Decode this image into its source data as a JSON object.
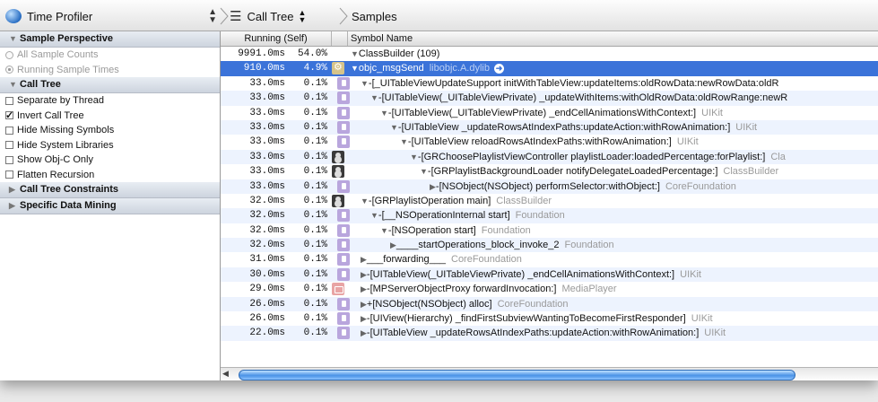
{
  "toolbar": {
    "instrument": "Time Profiler",
    "breadcrumb_1": "Call Tree",
    "breadcrumb_2": "Samples"
  },
  "sidebar": {
    "sample_perspective": {
      "title": "Sample Perspective",
      "options": [
        {
          "label": "All Sample Counts",
          "selected": false
        },
        {
          "label": "Running Sample Times",
          "selected": true
        }
      ]
    },
    "call_tree": {
      "title": "Call Tree",
      "options": [
        {
          "label": "Separate by Thread",
          "checked": false
        },
        {
          "label": "Invert Call Tree",
          "checked": true
        },
        {
          "label": "Hide Missing Symbols",
          "checked": false
        },
        {
          "label": "Hide System Libraries",
          "checked": false
        },
        {
          "label": "Show Obj-C Only",
          "checked": false
        },
        {
          "label": "Flatten Recursion",
          "checked": false
        }
      ]
    },
    "constraints_title": "Call Tree Constraints",
    "data_mining_title": "Specific Data Mining"
  },
  "table": {
    "col_running": "Running (Self)",
    "col_symbol": "Symbol Name",
    "rows": [
      {
        "ms": "9991.0ms",
        "pct": "54.0%",
        "icon": "",
        "indent": 0,
        "tri": "▼",
        "symbol": "ClassBuilder (109)",
        "lib": ""
      },
      {
        "ms": "910.0ms",
        "pct": "4.9%",
        "icon": "gear",
        "indent": 0,
        "tri": "▼",
        "symbol": "objc_msgSend",
        "lib": "libobjc.A.dylib",
        "selected": true
      },
      {
        "ms": "33.0ms",
        "pct": "0.1%",
        "icon": "lib",
        "indent": 1,
        "tri": "▼",
        "symbol": "-[_UITableViewUpdateSupport initWithTableView:updateItems:oldRowData:newRowData:oldR",
        "lib": ""
      },
      {
        "ms": "33.0ms",
        "pct": "0.1%",
        "icon": "lib",
        "indent": 2,
        "tri": "▼",
        "symbol": "-[UITableView(_UITableViewPrivate) _updateWithItems:withOldRowData:oldRowRange:newR",
        "lib": ""
      },
      {
        "ms": "33.0ms",
        "pct": "0.1%",
        "icon": "lib",
        "indent": 3,
        "tri": "▼",
        "symbol": "-[UITableView(_UITableViewPrivate) _endCellAnimationsWithContext:]",
        "lib": "UIKit"
      },
      {
        "ms": "33.0ms",
        "pct": "0.1%",
        "icon": "lib",
        "indent": 4,
        "tri": "▼",
        "symbol": "-[UITableView _updateRowsAtIndexPaths:updateAction:withRowAnimation:]",
        "lib": "UIKit"
      },
      {
        "ms": "33.0ms",
        "pct": "0.1%",
        "icon": "lib",
        "indent": 5,
        "tri": "▼",
        "symbol": "-[UITableView reloadRowsAtIndexPaths:withRowAnimation:]",
        "lib": "UIKit"
      },
      {
        "ms": "33.0ms",
        "pct": "0.1%",
        "icon": "usr",
        "indent": 6,
        "tri": "▼",
        "symbol": "-[GRChoosePlaylistViewController playlistLoader:loadedPercentage:forPlaylist:]",
        "lib": "Cla"
      },
      {
        "ms": "33.0ms",
        "pct": "0.1%",
        "icon": "usr",
        "indent": 7,
        "tri": "▼",
        "symbol": "-[GRPlaylistBackgroundLoader notifyDelegateLoadedPercentage:]",
        "lib": "ClassBuilder"
      },
      {
        "ms": "33.0ms",
        "pct": "0.1%",
        "icon": "lib",
        "indent": 8,
        "tri": "▶",
        "symbol": "-[NSObject(NSObject) performSelector:withObject:]",
        "lib": "CoreFoundation"
      },
      {
        "ms": "32.0ms",
        "pct": "0.1%",
        "icon": "usr",
        "indent": 1,
        "tri": "▼",
        "symbol": "-[GRPlaylistOperation main]",
        "lib": "ClassBuilder"
      },
      {
        "ms": "32.0ms",
        "pct": "0.1%",
        "icon": "lib",
        "indent": 2,
        "tri": "▼",
        "symbol": "-[__NSOperationInternal start]",
        "lib": "Foundation"
      },
      {
        "ms": "32.0ms",
        "pct": "0.1%",
        "icon": "lib",
        "indent": 3,
        "tri": "▼",
        "symbol": "-[NSOperation start]",
        "lib": "Foundation"
      },
      {
        "ms": "32.0ms",
        "pct": "0.1%",
        "icon": "lib",
        "indent": 4,
        "tri": "▶",
        "symbol": "____startOperations_block_invoke_2",
        "lib": "Foundation"
      },
      {
        "ms": "31.0ms",
        "pct": "0.1%",
        "icon": "lib",
        "indent": 1,
        "tri": "▶",
        "symbol": "___forwarding___",
        "lib": "CoreFoundation"
      },
      {
        "ms": "30.0ms",
        "pct": "0.1%",
        "icon": "lib",
        "indent": 1,
        "tri": "▶",
        "symbol": "-[UITableView(_UITableViewPrivate) _endCellAnimationsWithContext:]",
        "lib": "UIKit"
      },
      {
        "ms": "29.0ms",
        "pct": "0.1%",
        "icon": "mp",
        "indent": 1,
        "tri": "▶",
        "symbol": "-[MPServerObjectProxy forwardInvocation:]",
        "lib": "MediaPlayer"
      },
      {
        "ms": "26.0ms",
        "pct": "0.1%",
        "icon": "lib",
        "indent": 1,
        "tri": "▶",
        "symbol": "+[NSObject(NSObject) alloc]",
        "lib": "CoreFoundation"
      },
      {
        "ms": "26.0ms",
        "pct": "0.1%",
        "icon": "lib",
        "indent": 1,
        "tri": "▶",
        "symbol": "-[UIView(Hierarchy) _findFirstSubviewWantingToBecomeFirstResponder]",
        "lib": "UIKit"
      },
      {
        "ms": "22.0ms",
        "pct": "0.1%",
        "icon": "lib",
        "indent": 1,
        "tri": "▶",
        "symbol": "-[UITableView _updateRowsAtIndexPaths:updateAction:withRowAnimation:]",
        "lib": "UIKit"
      }
    ]
  },
  "scrollbar": {
    "position_fraction": 0.0,
    "visible_fraction": 0.87
  }
}
